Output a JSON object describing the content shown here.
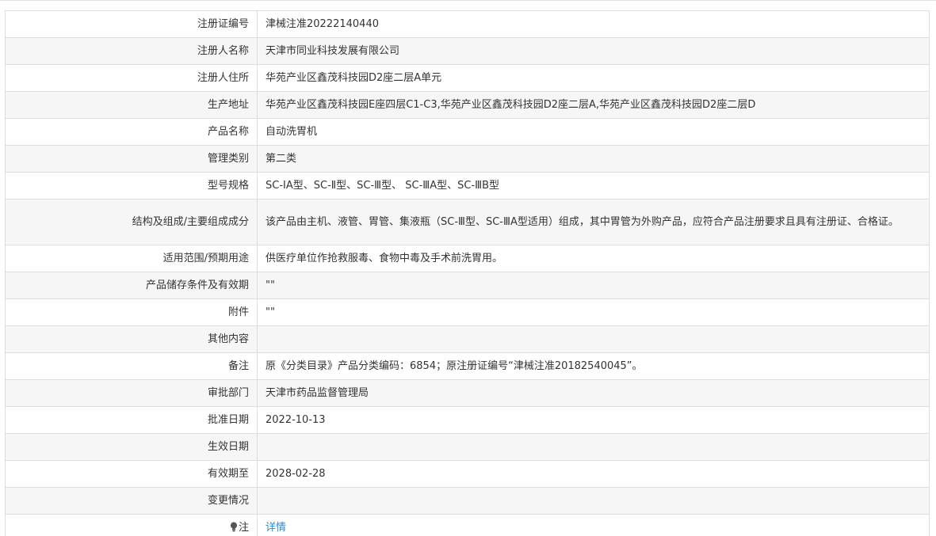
{
  "rows": [
    {
      "label": "注册证编号",
      "value": "津械注准20222140440"
    },
    {
      "label": "注册人名称",
      "value": "天津市同业科技发展有限公司"
    },
    {
      "label": "注册人住所",
      "value": "华苑产业区鑫茂科技园D2座二层A单元"
    },
    {
      "label": "生产地址",
      "value": "华苑产业区鑫茂科技园E座四层C1-C3,华苑产业区鑫茂科技园D2座二层A,华苑产业区鑫茂科技园D2座二层D"
    },
    {
      "label": "产品名称",
      "value": "自动洗胃机"
    },
    {
      "label": "管理类别",
      "value": "第二类"
    },
    {
      "label": "型号规格",
      "value": "SC-ⅠA型、SC-Ⅱ型、SC-Ⅲ型、 SC-ⅢA型、SC-ⅢB型"
    },
    {
      "label": "结构及组成/主要组成成分",
      "value": "该产品由主机、液管、胃管、集液瓶（SC-Ⅲ型、SC-ⅢA型适用）组成，其中胃管为外购产品，应符合产品注册要求且具有注册证、合格证。"
    },
    {
      "label": "适用范围/预期用途",
      "value": "供医疗单位作抢救服毒、食物中毒及手术前洗胃用。"
    },
    {
      "label": "产品储存条件及有效期",
      "value": "\"\""
    },
    {
      "label": "附件",
      "value": "\"\""
    },
    {
      "label": "其他内容",
      "value": ""
    },
    {
      "label": "备注",
      "value": "原《分类目录》产品分类编码：6854；原注册证编号“津械注准20182540045”。"
    },
    {
      "label": "审批部门",
      "value": "天津市药品监督管理局"
    },
    {
      "label": "批准日期",
      "value": "2022-10-13"
    },
    {
      "label": "生效日期",
      "value": ""
    },
    {
      "label": "有效期至",
      "value": "2028-02-28"
    },
    {
      "label": "变更情况",
      "value": ""
    }
  ],
  "note_row": {
    "label": "注",
    "icon": "bulb-icon",
    "link_text": "详情",
    "link_color": "#2a8ad6"
  }
}
